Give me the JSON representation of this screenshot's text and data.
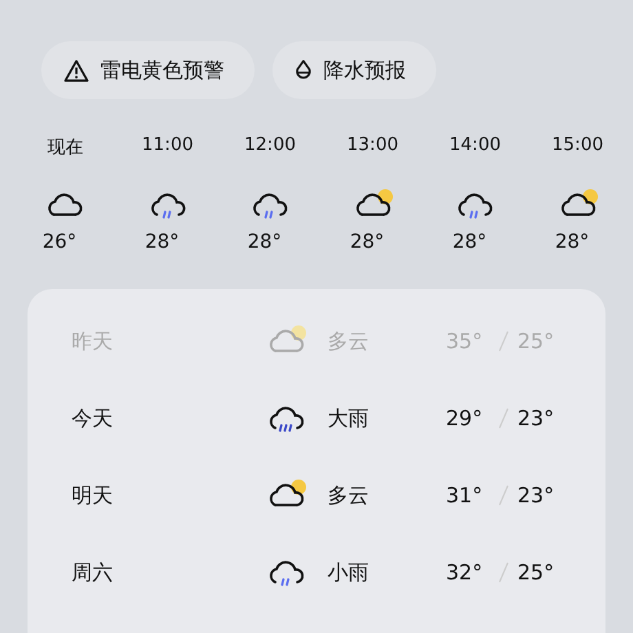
{
  "alerts": [
    {
      "kind": "warning",
      "label": "雷电黄色预警"
    },
    {
      "kind": "drop",
      "label": "降水预报"
    }
  ],
  "hourly": [
    {
      "time": "现在",
      "kind": "cloudy",
      "temp": "26°"
    },
    {
      "time": "11:00",
      "kind": "rain",
      "temp": "28°"
    },
    {
      "time": "12:00",
      "kind": "rain",
      "temp": "28°"
    },
    {
      "time": "13:00",
      "kind": "partly_cloudy",
      "temp": "28°"
    },
    {
      "time": "14:00",
      "kind": "rain",
      "temp": "28°"
    },
    {
      "time": "15:00",
      "kind": "partly_cloudy",
      "temp": "28°"
    }
  ],
  "daily": [
    {
      "day": "昨天",
      "past": true,
      "kind": "partly_cloudy",
      "desc": "多云",
      "high": "35°",
      "low": "25°"
    },
    {
      "day": "今天",
      "past": false,
      "kind": "heavy_rain",
      "desc": "大雨",
      "high": "29°",
      "low": "23°"
    },
    {
      "day": "明天",
      "past": false,
      "kind": "partly_cloudy",
      "desc": "多云",
      "high": "31°",
      "low": "23°"
    },
    {
      "day": "周六",
      "past": false,
      "kind": "rain",
      "desc": "小雨",
      "high": "32°",
      "low": "25°"
    }
  ]
}
